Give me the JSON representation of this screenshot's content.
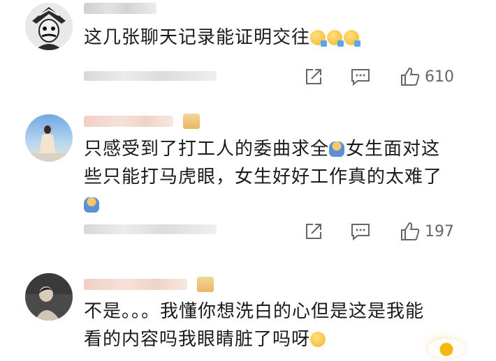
{
  "comments": [
    {
      "text": "这几张聊天记录能证明交往",
      "emoji_suffix": [
        "surprised-emoji",
        "surprised-emoji",
        "surprised-emoji"
      ],
      "like_count": "610"
    },
    {
      "text": "只感受到了打工人的委曲求全",
      "text_after_emoji": "女生面对这些只能打马虎眼，女生好好工作真的太难了",
      "emoji_mid": "crying-person-emoji",
      "emoji_end": "crying-person-emoji",
      "like_count": "197"
    },
    {
      "text": "不是。。。我懂你想洗白的心但是这是我能看的内容吗我眼睛脏了吗呀",
      "emoji_suffix": [
        "surprised-emoji"
      ]
    }
  ],
  "icons": {
    "share": "share-icon",
    "comment": "comment-icon",
    "like": "thumbs-up-icon"
  },
  "colors": {
    "text": "#1a1a1a",
    "icon": "#666666"
  }
}
